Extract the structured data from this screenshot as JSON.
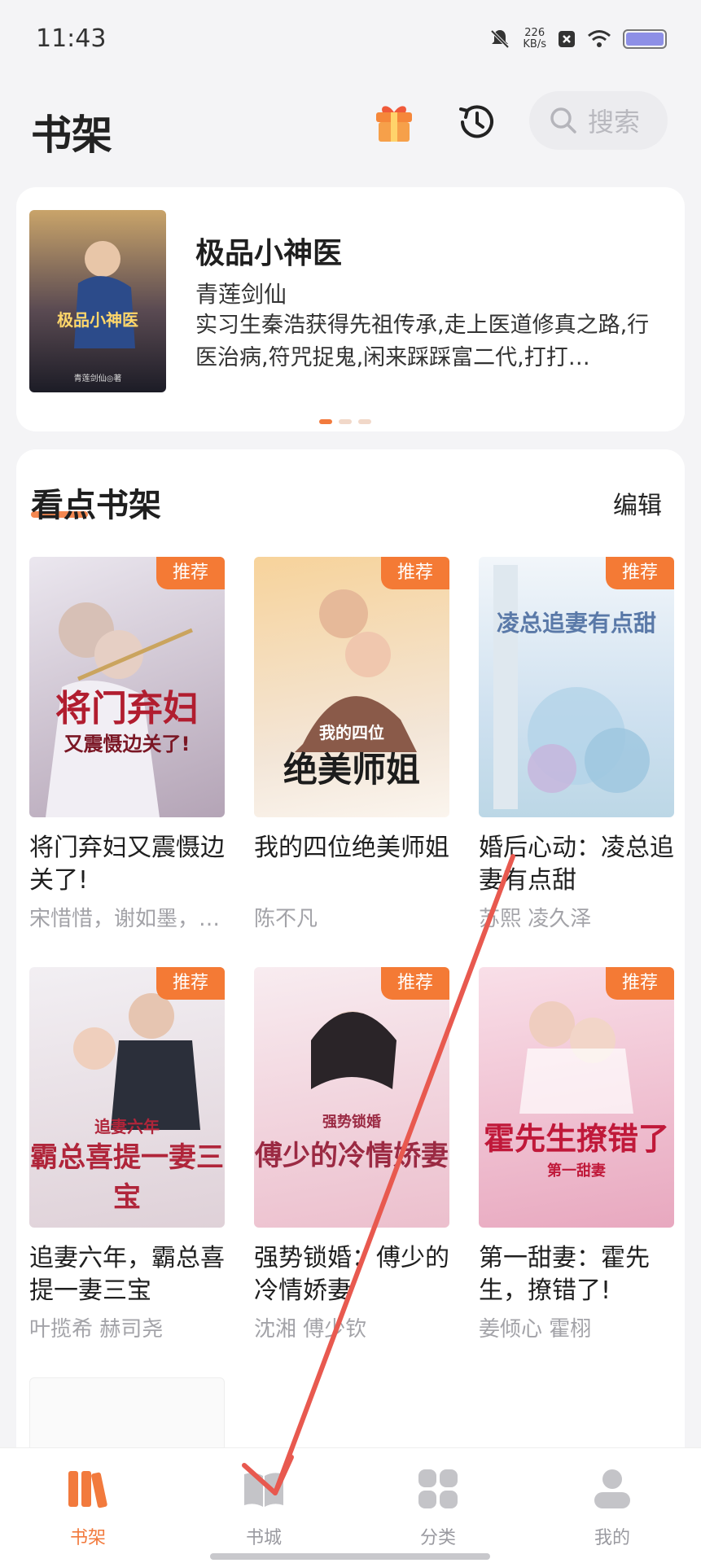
{
  "status_bar": {
    "time": "11:43",
    "net_speed_value": "226",
    "net_speed_unit": "KB/s",
    "battery_color": "#8d8fe6"
  },
  "header": {
    "title": "书架",
    "search_placeholder": "搜索",
    "gift_icon": "gift-icon",
    "history_icon": "history-icon"
  },
  "featured": {
    "title": "极品小神医",
    "author": "青莲剑仙",
    "description": "实习生秦浩获得先祖传承,走上医道修真之路,行医治病,符咒捉鬼,闲来踩踩富二代,打打…",
    "cover_text": "极品小神医",
    "cover_author": "青莲剑仙◎著",
    "pages": 3,
    "active_page": 1
  },
  "shelf": {
    "title": "看点书架",
    "edit_label": "编辑",
    "tag_label": "推荐",
    "books": [
      {
        "title": "将门弃妇又震慑边关了!",
        "author": "宋惜惜，谢如墨，…",
        "cover_text": "将门弃妇",
        "cover_sub": "又震慑边关了!",
        "cover_colors": [
          "#e9e6ee",
          "#b9a9b8"
        ]
      },
      {
        "title": "我的四位绝美师姐",
        "author": "陈不凡",
        "cover_text": "绝美师姐",
        "cover_sub": "我的四位",
        "cover_colors": [
          "#f6c98f",
          "#f2e3d6"
        ]
      },
      {
        "title": "婚后心动：凌总追妻有点甜",
        "author": "苏熙  凌久泽",
        "cover_text": "凌总追妻有点甜",
        "cover_sub": "",
        "cover_colors": [
          "#eef3f8",
          "#c7dcef"
        ]
      },
      {
        "title": "追妻六年，霸总喜提一妻三宝",
        "author": "叶揽希  赫司尧",
        "cover_text": "霸总喜提一妻三宝",
        "cover_sub": "追妻六年",
        "cover_colors": [
          "#f1eef2",
          "#d8c6cf"
        ]
      },
      {
        "title": "强势锁婚：傅少的冷情娇妻",
        "author": "沈湘  傅少钦",
        "cover_text": "傅少的冷情娇妻",
        "cover_sub": "强势锁婚",
        "cover_colors": [
          "#f7e6ec",
          "#e7b9c8"
        ]
      },
      {
        "title": "第一甜妻：霍先生，撩错了!",
        "author": "姜倾心  霍栩",
        "cover_text": "霍先生撩错了",
        "cover_sub": "第一甜妻",
        "cover_colors": [
          "#f7d9e3",
          "#e9a9be"
        ]
      }
    ]
  },
  "tabbar": {
    "tabs": [
      {
        "label": "书架",
        "active": true
      },
      {
        "label": "书城",
        "active": false
      },
      {
        "label": "分类",
        "active": false
      },
      {
        "label": "我的",
        "active": false
      }
    ]
  },
  "colors": {
    "accent": "#f27a3d",
    "tag": "#f47a35",
    "arrow": "#e8594f"
  }
}
